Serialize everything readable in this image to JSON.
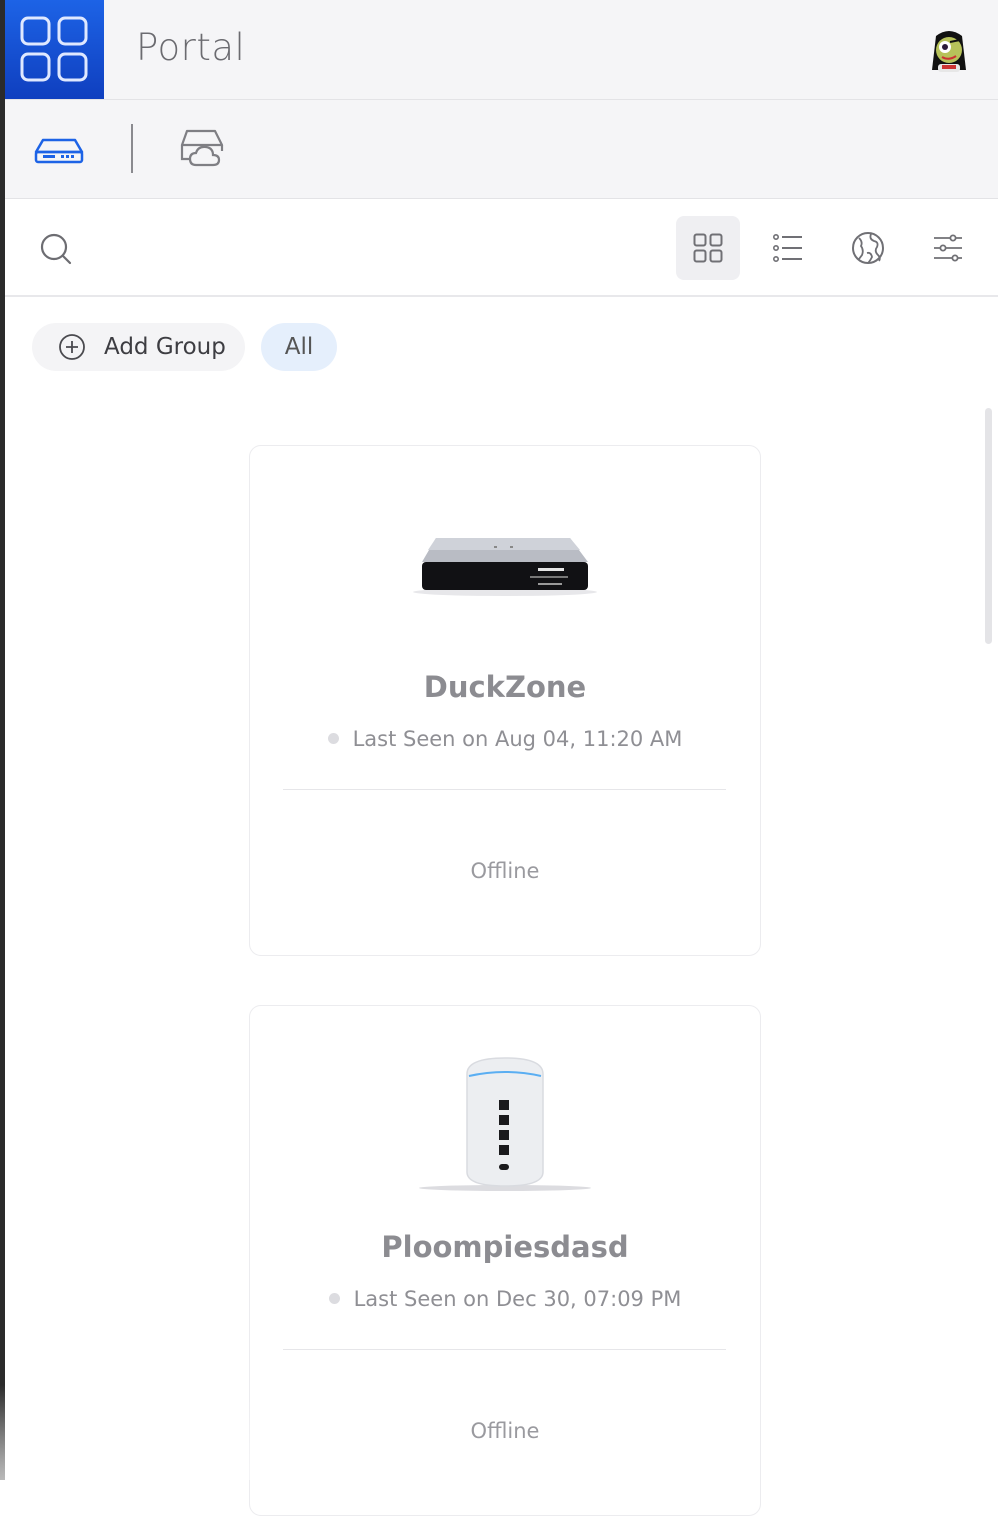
{
  "app": {
    "title": "Portal"
  },
  "toolbar": {
    "add_group_label": "Add Group",
    "filter_all_label": "All"
  },
  "colors": {
    "accent": "#1d63e6",
    "selected_chip": "#e5effc"
  },
  "devices": [
    {
      "name": "DuckZone",
      "last_seen": "Last Seen on Aug 04, 11:20 AM",
      "status": "Offline"
    },
    {
      "name": "Ploompiesdasd",
      "last_seen": "Last Seen on Dec 30, 07:09 PM",
      "status": "Offline"
    }
  ]
}
